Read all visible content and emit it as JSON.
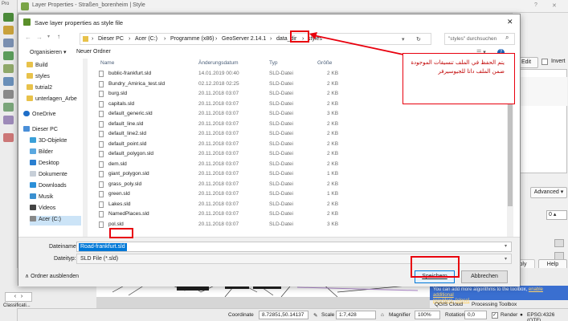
{
  "qgis": {
    "props_title": "Layer Properties - Straßen_borenheim | Style",
    "help_mark": "?",
    "close_mark": "✕",
    "left_label": "Pro",
    "edit_label": "Edit",
    "invert_label": "Invert",
    "advanced_label": "Advanced",
    "spin_value": "0",
    "apply_partial": "ply",
    "help_label": "Help",
    "classification_label": "Classificati...",
    "processing_msg_1": "You can add more algorithms to the toolbox,",
    "processing_link_1": "enable additional",
    "processing_link_2": "providers.",
    "processing_link_3": "[close]",
    "proc_tab_1": "QGIS Cloud",
    "proc_tab_2": "Processing Toolbox",
    "status": {
      "coordinate_label": "Coordinate",
      "coordinate_value": "8.72851,50.14137",
      "scale_label": "Scale",
      "scale_value": "1:7,428",
      "magnifier_label": "Magnifier",
      "magnifier_value": "100%",
      "rotation_label": "Rotation",
      "rotation_value": "0,0",
      "render_label": "Render",
      "crs_label": "EPSG:4326 (OTF)"
    }
  },
  "dialog": {
    "title": "Save layer properties as style file",
    "close": "✕",
    "breadcrumb": [
      "Dieser PC",
      "Acer (C:)",
      "Programme (x86)",
      "GeoServer 2.14.1",
      "data_dir",
      "styles"
    ],
    "search_placeholder": "\"styles\" durchsuchen",
    "organize": "Organisieren ▾",
    "new_folder": "Neuer Ordner",
    "nav_items": [
      "Build",
      "styles",
      "tutrial2",
      "unterlagen_Arbe",
      "OneDrive",
      "Dieser PC",
      "3D-Objekte",
      "Bilder",
      "Desktop",
      "Dokumente",
      "Downloads",
      "Musik",
      "Videos",
      "Acer (C:)"
    ],
    "columns": {
      "name": "Name",
      "date": "Änderungsdatum",
      "type": "Typ",
      "size": "Größe"
    },
    "files": [
      {
        "name": "bublic-frankfurt.sld",
        "date": "14.01.2019 00:40",
        "type": "SLD-Datei",
        "size": "2 KB"
      },
      {
        "name": "Bundry_Amirica_test.sld",
        "date": "02.12.2018 02:25",
        "type": "SLD-Datei",
        "size": "2 KB"
      },
      {
        "name": "burg.sld",
        "date": "20.11.2018 03:07",
        "type": "SLD-Datei",
        "size": "2 KB"
      },
      {
        "name": "capitals.sld",
        "date": "20.11.2018 03:07",
        "type": "SLD-Datei",
        "size": "2 KB"
      },
      {
        "name": "default_generic.sld",
        "date": "20.11.2018 03:07",
        "type": "SLD-Datei",
        "size": "3 KB"
      },
      {
        "name": "default_line.sld",
        "date": "20.11.2018 03:07",
        "type": "SLD-Datei",
        "size": "2 KB"
      },
      {
        "name": "default_line2.sld",
        "date": "20.11.2018 03:07",
        "type": "SLD-Datei",
        "size": "2 KB"
      },
      {
        "name": "default_point.sld",
        "date": "20.11.2018 03:07",
        "type": "SLD-Datei",
        "size": "2 KB"
      },
      {
        "name": "default_polygon.sld",
        "date": "20.11.2018 03:07",
        "type": "SLD-Datei",
        "size": "2 KB"
      },
      {
        "name": "dem.sld",
        "date": "20.11.2018 03:07",
        "type": "SLD-Datei",
        "size": "2 KB"
      },
      {
        "name": "giant_polygon.sld",
        "date": "20.11.2018 03:07",
        "type": "SLD-Datei",
        "size": "1 KB"
      },
      {
        "name": "grass_poly.sld",
        "date": "20.11.2018 03:07",
        "type": "SLD-Datei",
        "size": "2 KB"
      },
      {
        "name": "green.sld",
        "date": "20.11.2018 03:07",
        "type": "SLD-Datei",
        "size": "1 KB"
      },
      {
        "name": "Lakes.sld",
        "date": "20.11.2018 03:07",
        "type": "SLD-Datei",
        "size": "2 KB"
      },
      {
        "name": "NamedPlaces.sld",
        "date": "20.11.2018 03:07",
        "type": "SLD-Datei",
        "size": "2 KB"
      },
      {
        "name": "pol.sld",
        "date": "20.11.2018 03:07",
        "type": "SLD-Datei",
        "size": "3 KB"
      }
    ],
    "filename_label": "Dateiname:",
    "filename_value": "Road-frankfurt.sld",
    "filetype_label": "Dateityp:",
    "filetype_value": "SLD File (*.sld)",
    "hide_folders": "Ordner ausblenden",
    "save_button": "Speichern",
    "cancel_button": "Abbrechen"
  },
  "annotation": {
    "text": "يتم الحفظ في الملف تنسيقات الموجودة ضمن الملف داتا للجيوسيرفر",
    "color": "#e8000d"
  }
}
